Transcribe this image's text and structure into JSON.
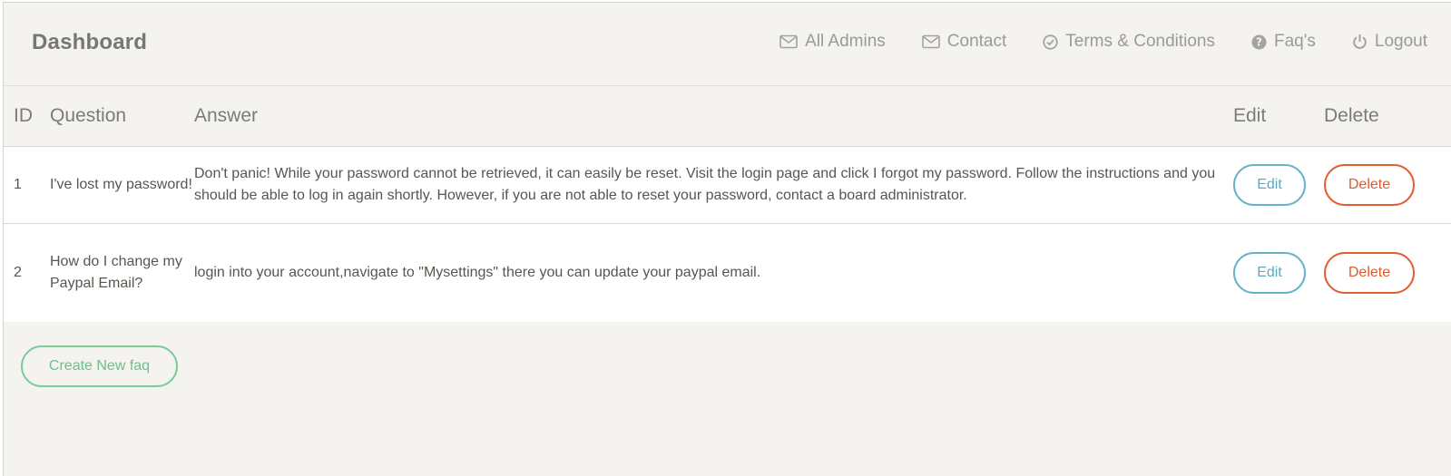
{
  "header": {
    "brand": "Dashboard",
    "nav": [
      {
        "label": "All Admins",
        "icon": "mail-icon"
      },
      {
        "label": "Contact",
        "icon": "mail-icon"
      },
      {
        "label": "Terms & Conditions",
        "icon": "check-circle-icon"
      },
      {
        "label": "Faq's",
        "icon": "question-circle-icon"
      },
      {
        "label": "Logout",
        "icon": "power-icon"
      }
    ]
  },
  "table": {
    "columns": [
      "ID",
      "Question",
      "Answer",
      "Edit",
      "Delete"
    ],
    "rows": [
      {
        "id": "1",
        "question": "I've lost my password!",
        "answer": "Don't panic! While your password cannot be retrieved, it can easily be reset. Visit the login page and click I forgot my password. Follow the instructions and you should be able to log in again shortly. However, if you are not able to reset your password, contact a board administrator.",
        "edit": "Edit",
        "delete": "Delete"
      },
      {
        "id": "2",
        "question": "How do I change my Paypal Email?",
        "answer": "login into your account,navigate to \"Mysettings\" there you can update your paypal email.",
        "edit": "Edit",
        "delete": "Delete"
      }
    ]
  },
  "actions": {
    "create_label": "Create New faq"
  },
  "colors": {
    "edit": "#5ea7be",
    "delete": "#de5a30",
    "create": "#6cbf8b",
    "background": "#f4f3f0"
  }
}
